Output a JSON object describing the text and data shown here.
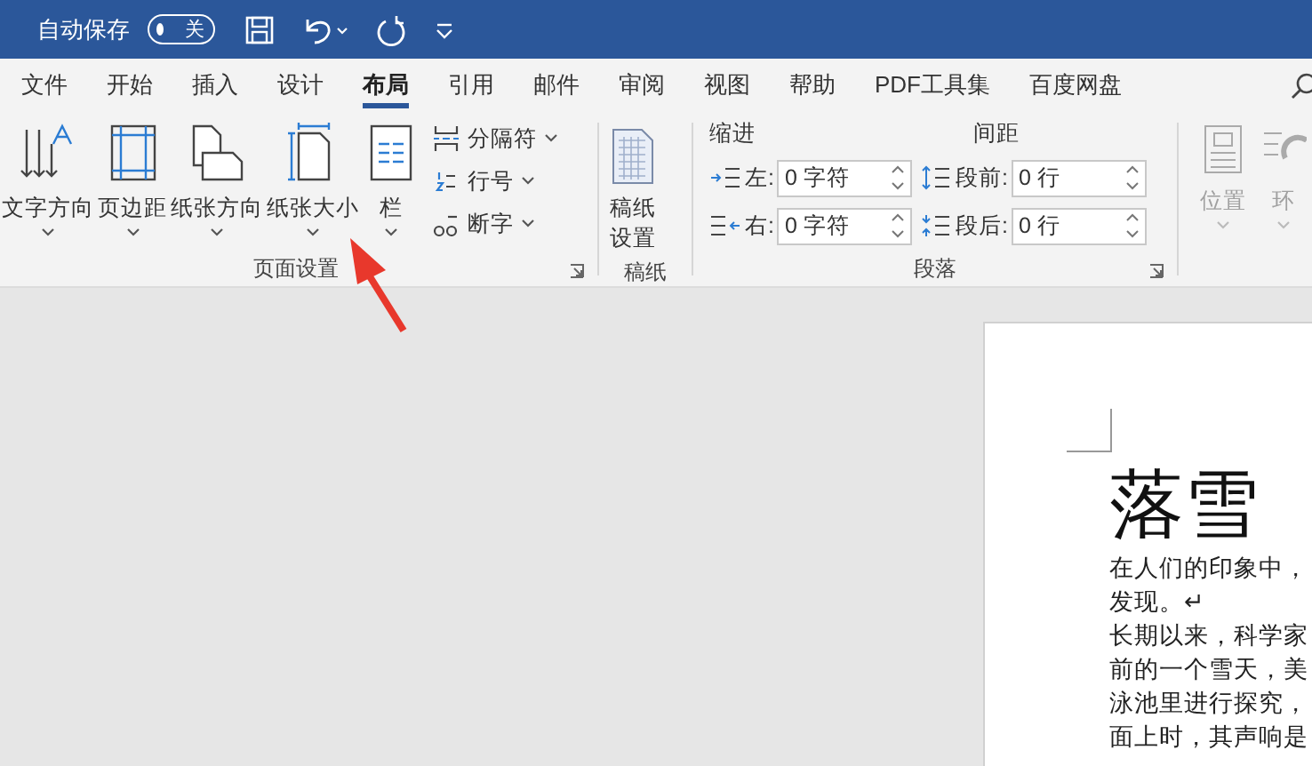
{
  "title_bar": {
    "autosave_label": "自动保存",
    "autosave": {
      "on": false,
      "label": "关"
    }
  },
  "tabs": [
    {
      "label": "文件",
      "selected": false
    },
    {
      "label": "开始",
      "selected": false
    },
    {
      "label": "插入",
      "selected": false
    },
    {
      "label": "设计",
      "selected": false
    },
    {
      "label": "布局",
      "selected": true
    },
    {
      "label": "引用",
      "selected": false
    },
    {
      "label": "邮件",
      "selected": false
    },
    {
      "label": "审阅",
      "selected": false
    },
    {
      "label": "视图",
      "selected": false
    },
    {
      "label": "帮助",
      "selected": false
    },
    {
      "label": "PDF工具集",
      "selected": false
    },
    {
      "label": "百度网盘",
      "selected": false
    }
  ],
  "page_setup": {
    "label": "页面设置",
    "big_buttons": [
      {
        "kind": "text-direction",
        "label": "文字方向"
      },
      {
        "kind": "margins",
        "label": "页边距"
      },
      {
        "kind": "orientation",
        "label": "纸张方向"
      },
      {
        "kind": "size",
        "label": "纸张大小"
      },
      {
        "kind": "columns",
        "label": "栏"
      }
    ],
    "small_buttons": [
      {
        "kind": "breaks",
        "label": "分隔符"
      },
      {
        "kind": "line-numbers",
        "label": "行号"
      },
      {
        "kind": "hyphenation",
        "label": "断字"
      }
    ]
  },
  "manuscript": {
    "label": "稿纸",
    "button": "稿纸设置"
  },
  "paragraph": {
    "label": "段落",
    "indent_heading": "缩进",
    "spacing_heading": "间距",
    "indent": [
      {
        "kind": "left",
        "label": "左:",
        "value": "0 字符"
      },
      {
        "kind": "right",
        "label": "右:",
        "value": "0 字符"
      }
    ],
    "spacing": [
      {
        "kind": "before",
        "label": "段前:",
        "value": "0 行"
      },
      {
        "kind": "after",
        "label": "段后:",
        "value": "0 行"
      }
    ]
  },
  "arrange": [
    {
      "kind": "position",
      "label": "位置",
      "disabled": true
    },
    {
      "kind": "wrap",
      "label": "环",
      "disabled": true
    }
  ],
  "document": {
    "title": "落雪",
    "lines": [
      "在人们的印象中，",
      "发现。↵",
      "长期以来，科学家",
      "前的一个雪天，美",
      "泳池里进行探究，",
      "面上时，其声响是"
    ]
  }
}
